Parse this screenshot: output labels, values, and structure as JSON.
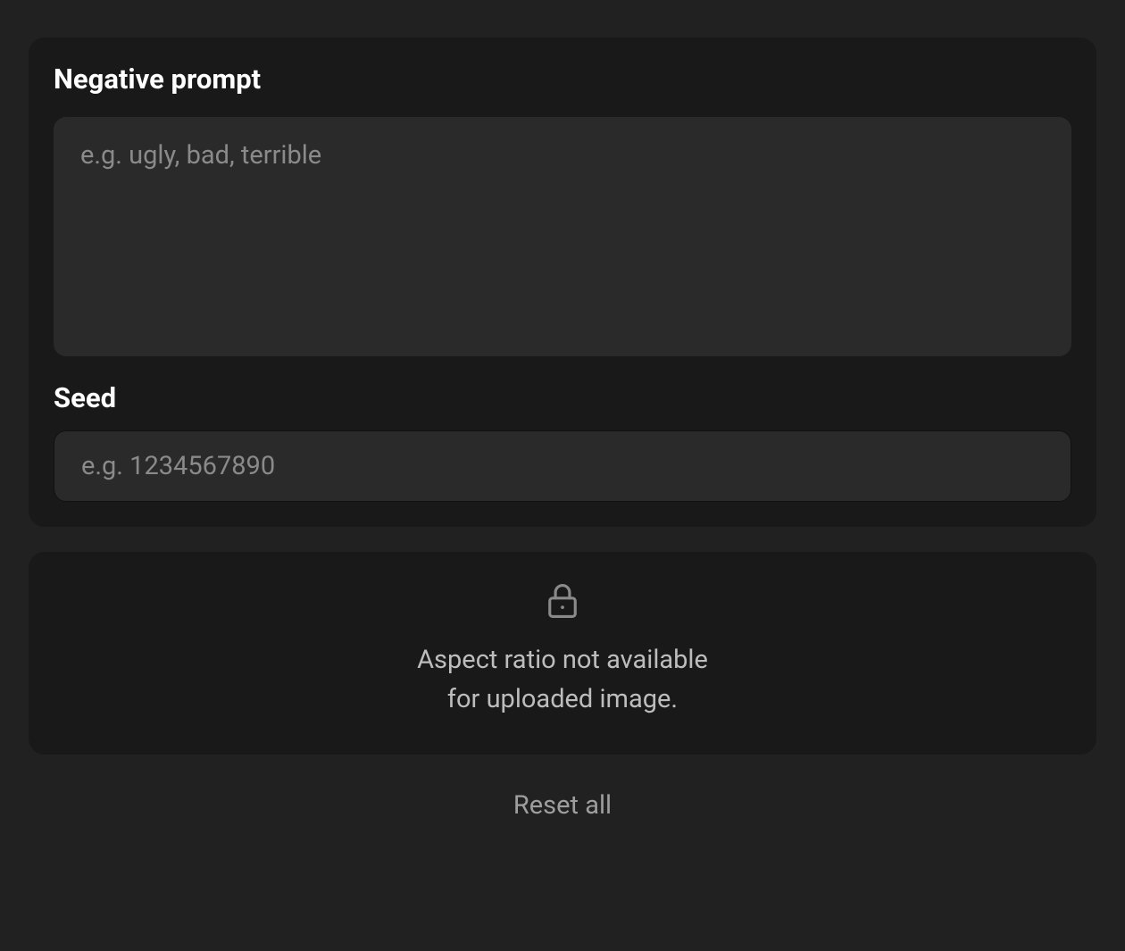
{
  "negative_prompt": {
    "heading": "Negative prompt",
    "placeholder": "e.g. ugly, bad, terrible",
    "value": ""
  },
  "seed": {
    "heading": "Seed",
    "placeholder": "e.g. 1234567890",
    "value": ""
  },
  "aspect_ratio_lock": {
    "line1": "Aspect ratio not available",
    "line2": "for uploaded image."
  },
  "reset_all_label": "Reset all"
}
